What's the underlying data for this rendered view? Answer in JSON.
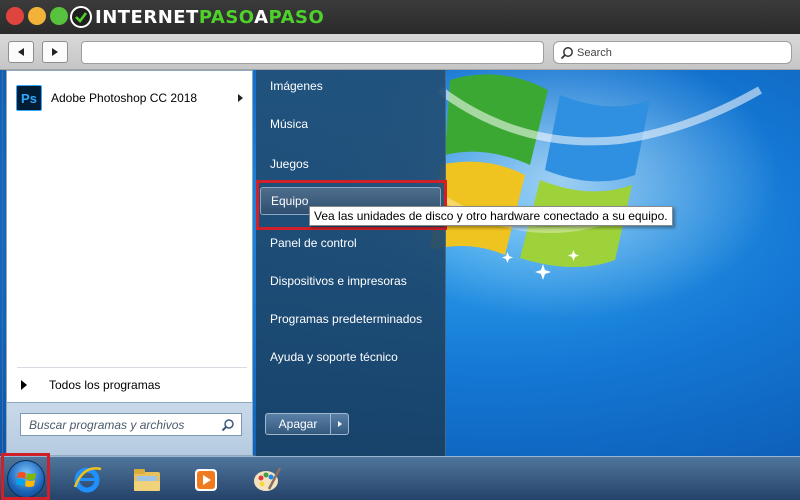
{
  "browser": {
    "brand": {
      "part1": "INTERNET",
      "part2": "PASO",
      "part3": "A",
      "part4": "PASO"
    },
    "search_placeholder": "Search"
  },
  "start_menu": {
    "pinned_app": {
      "label": "Adobe Photoshop CC 2018",
      "icon_text": "Ps"
    },
    "all_programs": "Todos los programas",
    "search_placeholder": "Buscar programas y archivos",
    "places": [
      {
        "label": "Imágenes"
      },
      {
        "label": "Música"
      },
      {
        "label": "Juegos"
      },
      {
        "label": "Equipo"
      },
      {
        "label": "Panel de control"
      },
      {
        "label": "Dispositivos e impresoras"
      },
      {
        "label": "Programas predeterminados"
      },
      {
        "label": "Ayuda y soporte técnico"
      }
    ],
    "shutdown_label": "Apagar",
    "tooltip": "Vea las unidades de disco y otro hardware conectado a su equipo."
  },
  "taskbar": {
    "icons": [
      "start-orb",
      "internet-explorer-icon",
      "windows-explorer-icon",
      "media-player-icon",
      "paint-icon"
    ]
  },
  "colors": {
    "highlight_frame": "#d0202a",
    "brand_green": "#4fd12c"
  }
}
